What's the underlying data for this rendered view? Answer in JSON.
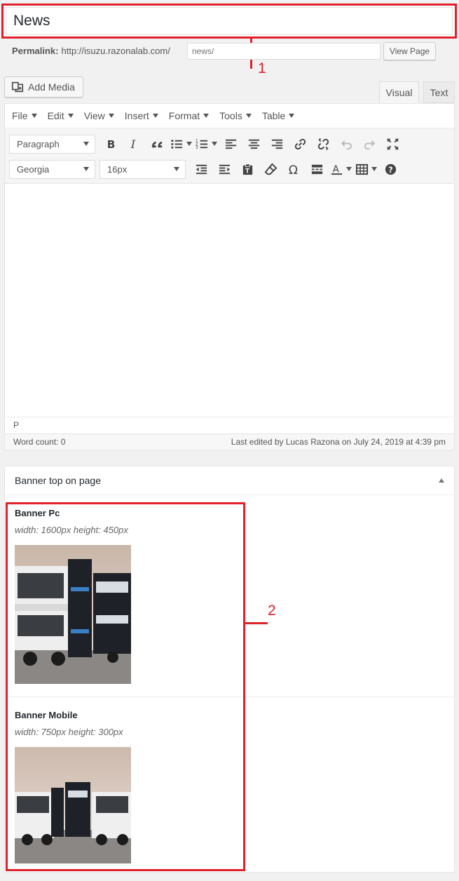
{
  "title": {
    "value": "News"
  },
  "permalink": {
    "label": "Permalink:",
    "base_url": "http://isuzu.razonalab.com/",
    "slug_placeholder": "news/",
    "view_button": "View Page"
  },
  "media": {
    "add_button": "Add Media"
  },
  "tabs": {
    "visual": "Visual",
    "text": "Text"
  },
  "menubar": [
    "File",
    "Edit",
    "View",
    "Insert",
    "Format",
    "Tools",
    "Table"
  ],
  "toolbar": {
    "format_select": "Paragraph",
    "font_select": "Georgia",
    "size_select": "16px"
  },
  "editor": {
    "path": "P",
    "word_count": "Word count: 0",
    "last_edited": "Last edited by Lucas Razona on July 24, 2019 at 4:39 pm"
  },
  "metabox": {
    "title": "Banner top on page",
    "fields": [
      {
        "label": "Banner Pc",
        "desc": "width: 1600px height: 450px"
      },
      {
        "label": "Banner Mobile",
        "desc": "width: 750px height: 300px"
      }
    ]
  },
  "annotations": {
    "one": "1",
    "two": "2"
  },
  "colors": {
    "annotation": "#e0202b",
    "accent_text": "#555555"
  }
}
